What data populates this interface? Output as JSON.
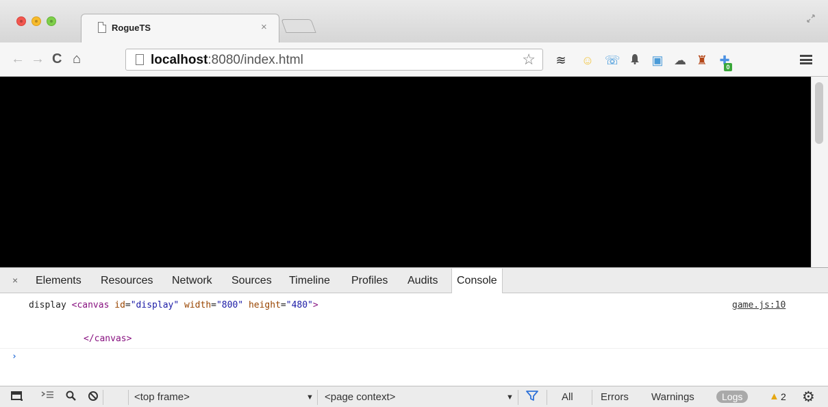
{
  "browser": {
    "tab": {
      "title": "RogueTS",
      "close": "×"
    },
    "address": {
      "host": "localhost",
      "rest": ":8080/index.html"
    },
    "nav": {
      "back": "←",
      "forward": "→",
      "reload": "C",
      "home": "⌂"
    },
    "star": "☆",
    "extensions": [
      {
        "name": "buffer-icon",
        "glyph": "≋"
      },
      {
        "name": "smiley-extension-icon",
        "glyph": "☺"
      },
      {
        "name": "phone-extension-icon",
        "glyph": "☏"
      },
      {
        "name": "bell-icon",
        "glyph": "🔔"
      },
      {
        "name": "photo-extension-icon",
        "glyph": "▣"
      },
      {
        "name": "cloud-extension-icon",
        "glyph": "☁"
      },
      {
        "name": "sofa-extension-icon",
        "glyph": "♜"
      },
      {
        "name": "plus-extension-icon",
        "glyph": "✚"
      }
    ],
    "extension_badge": "0"
  },
  "devtools": {
    "close": "×",
    "tabs": [
      "Elements",
      "Resources",
      "Network",
      "Sources",
      "Timeline",
      "Profiles",
      "Audits",
      "Console"
    ],
    "active_tab": "Console",
    "console": {
      "label": "display",
      "open_tag": "<canvas",
      "attrs": [
        {
          "name": "id",
          "value": "\"display\""
        },
        {
          "name": "width",
          "value": "\"800\""
        },
        {
          "name": "height",
          "value": "\"480\""
        }
      ],
      "open_tag_end": ">",
      "close_tag": "</canvas>",
      "source": "game.js:10",
      "prompt": "›"
    },
    "statusbar": {
      "frame": "<top frame>",
      "context": "<page context>",
      "filters": [
        "All",
        "Errors",
        "Warnings"
      ],
      "logs": "Logs",
      "warning_count": "2",
      "dropdown_arrow": "▼"
    }
  },
  "colors": {
    "viewport": "#000000",
    "tag": "#881280",
    "attr": "#994500",
    "value": "#1a1aa6"
  }
}
